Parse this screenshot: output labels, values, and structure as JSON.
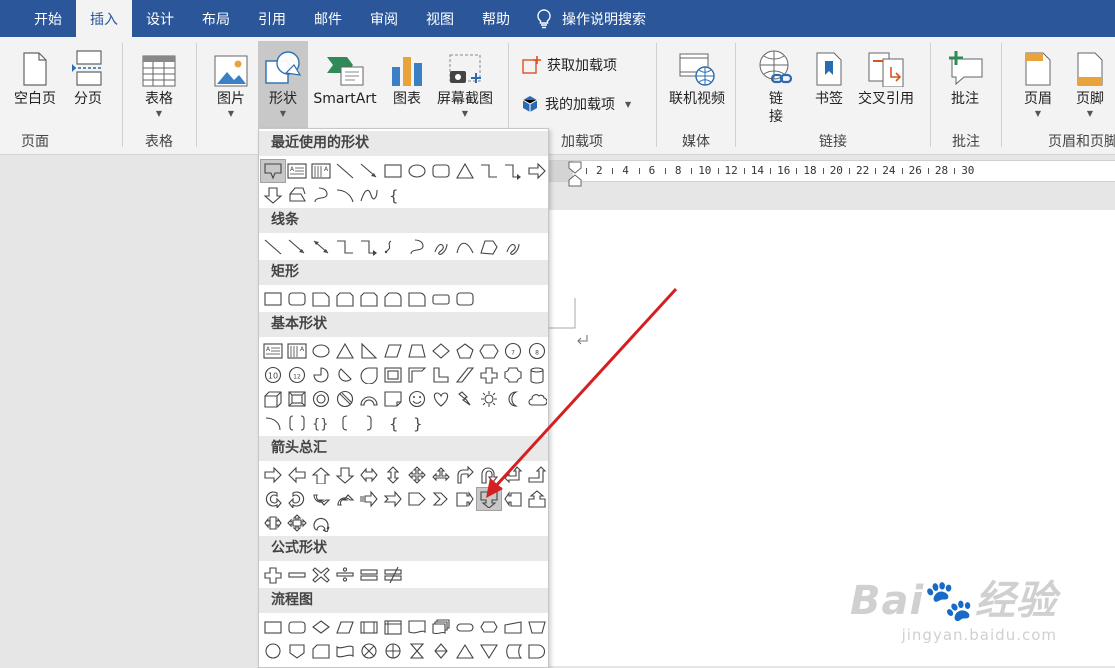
{
  "tabs": [
    "开始",
    "插入",
    "设计",
    "布局",
    "引用",
    "邮件",
    "审阅",
    "视图",
    "帮助"
  ],
  "active_tab": "插入",
  "tell_me": "操作说明搜索",
  "ribbon": {
    "pages": {
      "label": "页面",
      "blank": "空白页",
      "break": "分页"
    },
    "tables": {
      "label": "表格",
      "table": "表格"
    },
    "illustrations": {
      "picture": "图片",
      "shapes": "形状",
      "smartart": "SmartArt",
      "chart": "图表",
      "screenshot": "屏幕截图"
    },
    "addins": {
      "label": "加载项",
      "get": "获取加载项",
      "my": "我的加载项"
    },
    "media": {
      "label": "媒体",
      "video": "联机视频"
    },
    "links": {
      "label": "链接",
      "link_line1": "链",
      "link_line2": "接",
      "bookmark": "书签",
      "crossref": "交叉引用"
    },
    "comments": {
      "label": "批注",
      "comment": "批注"
    },
    "headerfooter": {
      "label": "页眉和页脚",
      "header": "页眉",
      "footer": "页脚"
    }
  },
  "ruler": [
    "2",
    "4",
    "6",
    "8",
    "10",
    "12",
    "14",
    "16",
    "18",
    "20",
    "22",
    "24",
    "26",
    "28",
    "30"
  ],
  "shapes_menu": {
    "recent": "最近使用的形状",
    "lines": "线条",
    "rect": "矩形",
    "basic": "基本形状",
    "arrows": "箭头总汇",
    "equation": "公式形状",
    "flowchart": "流程图"
  },
  "basic_labels": {
    "seven": "7",
    "eight": "8",
    "ten": "10",
    "twelve": "12"
  },
  "watermark": {
    "brand": "Bai",
    "brand2": "经验",
    "url": "jingyan.baidu.com"
  },
  "colors": {
    "tabbar": "#2b579a",
    "annotation": "#d42020"
  }
}
